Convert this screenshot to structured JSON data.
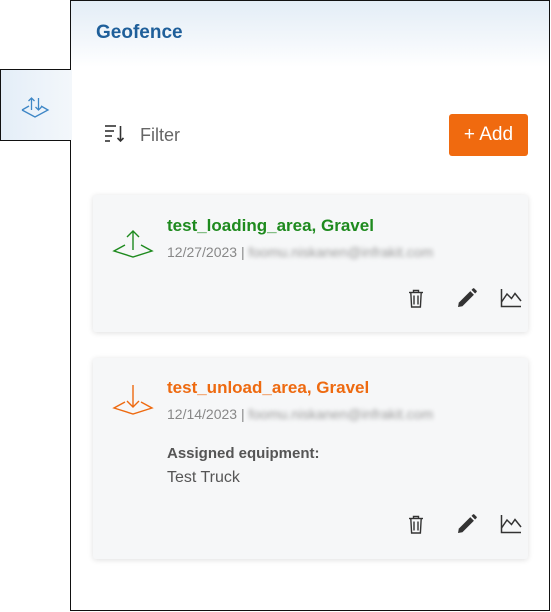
{
  "panel": {
    "title": "Geofence"
  },
  "side_tab": {
    "icon": "geofence-layers-icon"
  },
  "toolbar": {
    "filter_label": "Filter",
    "filter_icon": "sort-filter-icon",
    "add_label": "+ Add",
    "add_color": "#f06a0f"
  },
  "geofences": [
    {
      "name": "test_loading_area, Gravel",
      "date": "12/27/2023",
      "separator": "|",
      "user": "foomu.niskanen@infrakit.com",
      "type": "loading",
      "type_icon": "upload-arrow-area-icon",
      "color": "#1e8a1e",
      "actions": [
        "delete-icon",
        "edit-icon",
        "chart-icon"
      ]
    },
    {
      "name": "test_unload_area, Gravel",
      "date": "12/14/2023",
      "separator": "|",
      "user": "foomu.niskanen@infrakit.com",
      "type": "unloading",
      "type_icon": "download-arrow-area-icon",
      "color": "#ee6a10",
      "assigned_label": "Assigned equipment:",
      "assigned_equipment": "Test Truck",
      "actions": [
        "delete-icon",
        "edit-icon",
        "chart-icon"
      ]
    }
  ]
}
